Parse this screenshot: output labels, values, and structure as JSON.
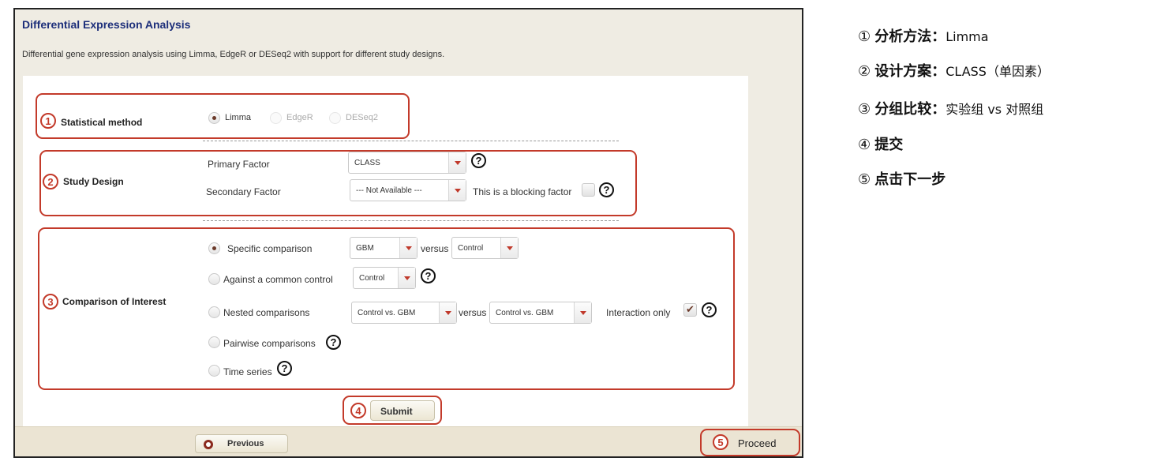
{
  "header": {
    "title": "Differential Expression Analysis",
    "description": "Differential gene expression analysis using Limma, EdgeR or DESeq2 with support for different study designs."
  },
  "callouts": [
    "1",
    "2",
    "3",
    "4",
    "5"
  ],
  "statistical_method": {
    "label": "Statistical method",
    "options": [
      "Limma",
      "EdgeR",
      "DESeq2"
    ],
    "selected": "Limma"
  },
  "study_design": {
    "label": "Study Design",
    "primary_label": "Primary Factor",
    "primary_value": "CLASS",
    "secondary_label": "Secondary Factor",
    "secondary_value": "--- Not Available ---",
    "blocking_label": "This is a blocking factor",
    "blocking_checked": false
  },
  "comparison": {
    "label": "Comparison of Interest",
    "specific_label": "Specific comparison",
    "specific_value1": "GBM",
    "versus": "versus",
    "specific_value2": "Control",
    "common_control_label": "Against a common control",
    "common_control_value": "Control",
    "nested_label": "Nested comparisons",
    "nested_value1": "Control vs. GBM",
    "nested_value2": "Control vs. GBM",
    "interaction_label": "Interaction only",
    "interaction_checked": true,
    "pairwise_label": "Pairwise comparisons",
    "timeseries_label": "Time series",
    "selected": "Specific comparison"
  },
  "buttons": {
    "submit": "Submit",
    "previous": "Previous",
    "proceed": "Proceed"
  },
  "notes": [
    {
      "num": "①",
      "bold": "分析方法：",
      "rest": "Limma"
    },
    {
      "num": "②",
      "bold": "设计方案：",
      "rest": "CLASS（单因素）"
    },
    {
      "num": "③",
      "bold": "分组比较：",
      "rest": "实验组 vs 对照组"
    },
    {
      "num": "④",
      "bold": "提交",
      "rest": ""
    },
    {
      "num": "⑤",
      "bold": "点击下一步",
      "rest": ""
    }
  ],
  "colors": {
    "accent_red": "#c33a2a",
    "title_blue": "#1c2e7a",
    "page_bg": "#efece3"
  }
}
